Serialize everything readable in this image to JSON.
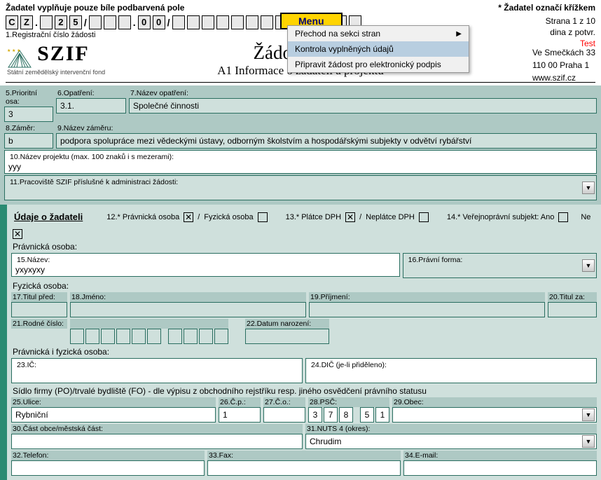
{
  "header": {
    "instruction_left": "Žadatel vyplňuje pouze bíle podbarvená pole",
    "instruction_right": "* Žadatel označí křížkem",
    "reg_label": "1.Registrační číslo žádosti",
    "reg_boxes": [
      "C",
      "Z",
      ".",
      "",
      "",
      "2",
      "5",
      "/",
      "",
      "",
      "",
      ".",
      "0",
      "0",
      "/",
      "",
      "",
      "",
      "",
      "",
      "",
      "",
      "",
      "",
      "",
      "",
      ""
    ],
    "page_info": "Strana 1 z 10",
    "dina": "dina z potvr.",
    "test": "Test",
    "menu_btn": "Menu",
    "menu_items": [
      "Přechod na sekci stran",
      "Kontrola vyplněných údajů",
      "Připravit žádost pro elektronický podpis"
    ]
  },
  "logo_sub": "Státní zemědělský intervenční fond",
  "logo_txt": "SZIF",
  "title": "Žádost o dot",
  "subtitle": "A1 Informace o žadateli a projektu",
  "addr": [
    "Ve Smečkách 33",
    "110 00 Praha 1",
    "www.szif.cz"
  ],
  "f": {
    "l5": "5.Prioritní osa:",
    "v5": "3",
    "l6": "6.Opatření:",
    "v6": "3.1.",
    "l7": "7.Název opatření:",
    "v7": "Společné činnosti",
    "l8": "8.Záměr:",
    "v8": "b",
    "l9": "9.Název záměru:",
    "v9": "podpora spolupráce mezi vědeckými ústavy, odborným školstvím a hospodářskými subjekty v odvětví rybářství",
    "l10": "10.Název projektu (max. 100 znaků i s mezerami):",
    "v10": "yyy",
    "l11": "11.Pracoviště SZIF příslušné k administraci žádosti:",
    "sec_udaje": "Údaje o žadateli",
    "c12": "12.* Právnická osoba",
    "c12b": "Fyzická osoba",
    "c13": "13.* Plátce DPH",
    "c13b": "Neplátce DPH",
    "c14": "14.* Veřejnoprávní subjekt: Ano",
    "c14b": "Ne",
    "h_prav": "Právnická osoba:",
    "l15": "15.Název:",
    "v15": "yxyxyxy",
    "l16": "16.Právní forma:",
    "h_fyz": "Fyzická osoba:",
    "l17": "17.Titul před:",
    "l18": "18.Jméno:",
    "l19": "19.Příjmení:",
    "l20": "20.Titul za:",
    "l21": "21.Rodné číslo:",
    "l22": "22.Datum narození:",
    "h_both": "Právnická i fyzická osoba:",
    "l23": "23.IČ:",
    "l24": "24.DIČ (je-li přiděleno):",
    "h_sidlo": "Sídlo firmy (PO)/trvalé bydliště (FO) - dle výpisu z obchodního rejstříku resp. jiného osvědčení právního statusu",
    "l25": "25.Ulice:",
    "v25": "Rybniční",
    "l26": "26.Č.p.:",
    "v26": "1",
    "l27": "27.Č.o.:",
    "l28": "28.PSČ:",
    "v28": [
      "3",
      "7",
      "8",
      "5",
      "1"
    ],
    "l29": "29.Obec:",
    "l30": "30.Část obce/městská část:",
    "l31": "31.NUTS 4 (okres):",
    "v31": "Chrudim",
    "l32": "32.Telefon:",
    "l33": "33.Fax:",
    "l34": "34.E-mail:"
  }
}
